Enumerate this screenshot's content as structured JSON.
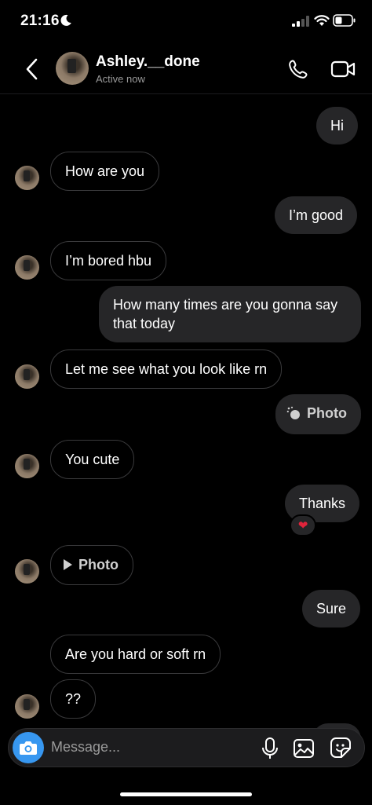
{
  "status_bar": {
    "time": "21:16"
  },
  "header": {
    "name": "Ashley.__done",
    "status": "Active now"
  },
  "messages": {
    "m1": "Hi",
    "m2": "How are you",
    "m3": "I’m good",
    "m4": "I’m bored hbu",
    "m5": "How many times are you gonna say that today",
    "m6": "Let me see what you look like rn",
    "m7": "Photo",
    "m8": "You cute",
    "m9": "Thanks",
    "m10": "Photo",
    "m11": "Sure",
    "m12": "Are you hard or soft rn",
    "m13": "??"
  },
  "reaction": "❤",
  "composer": {
    "placeholder": "Message..."
  },
  "colors": {
    "background": "#000000",
    "outgoing_bubble": "#262628",
    "accent": "#3797f0",
    "reaction": "#e0243b"
  },
  "icons": [
    "moon-icon",
    "signal-icon",
    "wifi-icon",
    "battery-icon",
    "back-chevron-icon",
    "phone-icon",
    "video-camera-icon",
    "camera-icon",
    "microphone-icon",
    "gallery-icon",
    "sticker-icon",
    "play-icon"
  ]
}
